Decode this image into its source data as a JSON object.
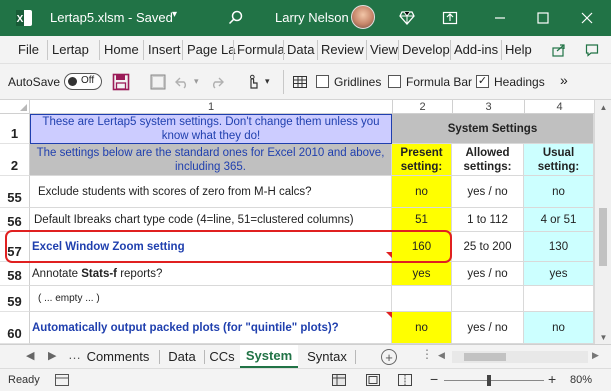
{
  "window": {
    "file_title": "Lertap5.xlsm  -  Saved",
    "user_name": "Larry Nelson",
    "colors": {
      "titlebar": "#217346",
      "accent": "#217346"
    }
  },
  "menu": {
    "items": [
      "File",
      "Lertap",
      "Home",
      "Insert",
      "Page La",
      "Formula",
      "Data",
      "Review",
      "View",
      "Develop",
      "Add-ins",
      "Help"
    ]
  },
  "qat": {
    "autosave_label": "AutoSave",
    "autosave_state": "Off",
    "gridlines_label": "Gridlines",
    "gridlines_checked": false,
    "formula_bar_label": "Formula Bar",
    "formula_bar_checked": false,
    "headings_label": "Headings",
    "headings_checked": true,
    "more": "»"
  },
  "columns": [
    "1",
    "2",
    "3",
    "4"
  ],
  "header": {
    "row1_label": "1",
    "row2_label": "2",
    "note_line1": "These are Lertap5 system settings. Don't change them unless you know what they do!",
    "note_line2": "The settings below are the standard ones for Excel 2010 and above, including 365.",
    "system_settings": "System Settings",
    "present": "Present setting:",
    "allowed": "Allowed settings:",
    "usual": "Usual setting:"
  },
  "rows": [
    {
      "num": "55",
      "label": "Exclude students with scores of zero from M-H calcs?",
      "present": "no",
      "allowed": "yes / no",
      "usual": "no"
    },
    {
      "num": "56",
      "label": "Default Ibreaks chart type code (4=line, 51=clustered columns)",
      "present": "51",
      "allowed": "1 to 112",
      "usual": "4 or 51"
    },
    {
      "num": "57",
      "label": "Excel Window Zoom setting",
      "present": "160",
      "allowed": "25 to 200",
      "usual": "130"
    },
    {
      "num": "58",
      "label_pre": "Annotate ",
      "label_bold": "Stats-f",
      "label_post": " reports?",
      "present": "yes",
      "allowed": "yes / no",
      "usual": "yes"
    },
    {
      "num": "59",
      "label": "( ... empty ... )",
      "present": "",
      "allowed": "",
      "usual": ""
    },
    {
      "num": "60",
      "label": "Automatically output packed plots (for \"quintile\" plots)?",
      "present": "no",
      "allowed": "yes / no",
      "usual": "no"
    }
  ],
  "sheets": {
    "tabs": [
      "Comments",
      "Data",
      "CCs",
      "System",
      "Syntax"
    ],
    "active": "System"
  },
  "status": {
    "ready": "Ready",
    "zoom": "80%"
  }
}
